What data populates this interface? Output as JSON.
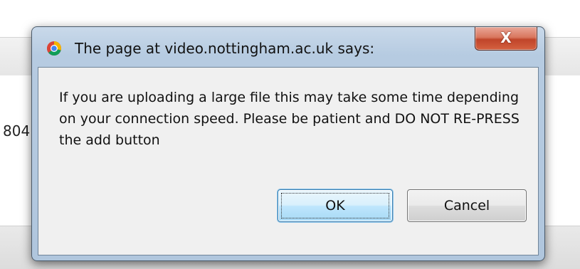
{
  "background": {
    "partial_text": "804"
  },
  "dialog": {
    "title": "The page at video.nottingham.ac.uk says:",
    "title_icon": "chrome-logo-icon",
    "close_glyph": "X",
    "message": "If you are uploading a large file this may take some time depending on your connection speed. Please be patient and DO NOT RE-PRESS the add button",
    "ok_label": "OK",
    "cancel_label": "Cancel"
  },
  "colors": {
    "frame": "#b6cbe1",
    "close_button": "#c0452a",
    "ok_focus": "#3c7fb1",
    "content_bg": "#f0f0f0"
  }
}
